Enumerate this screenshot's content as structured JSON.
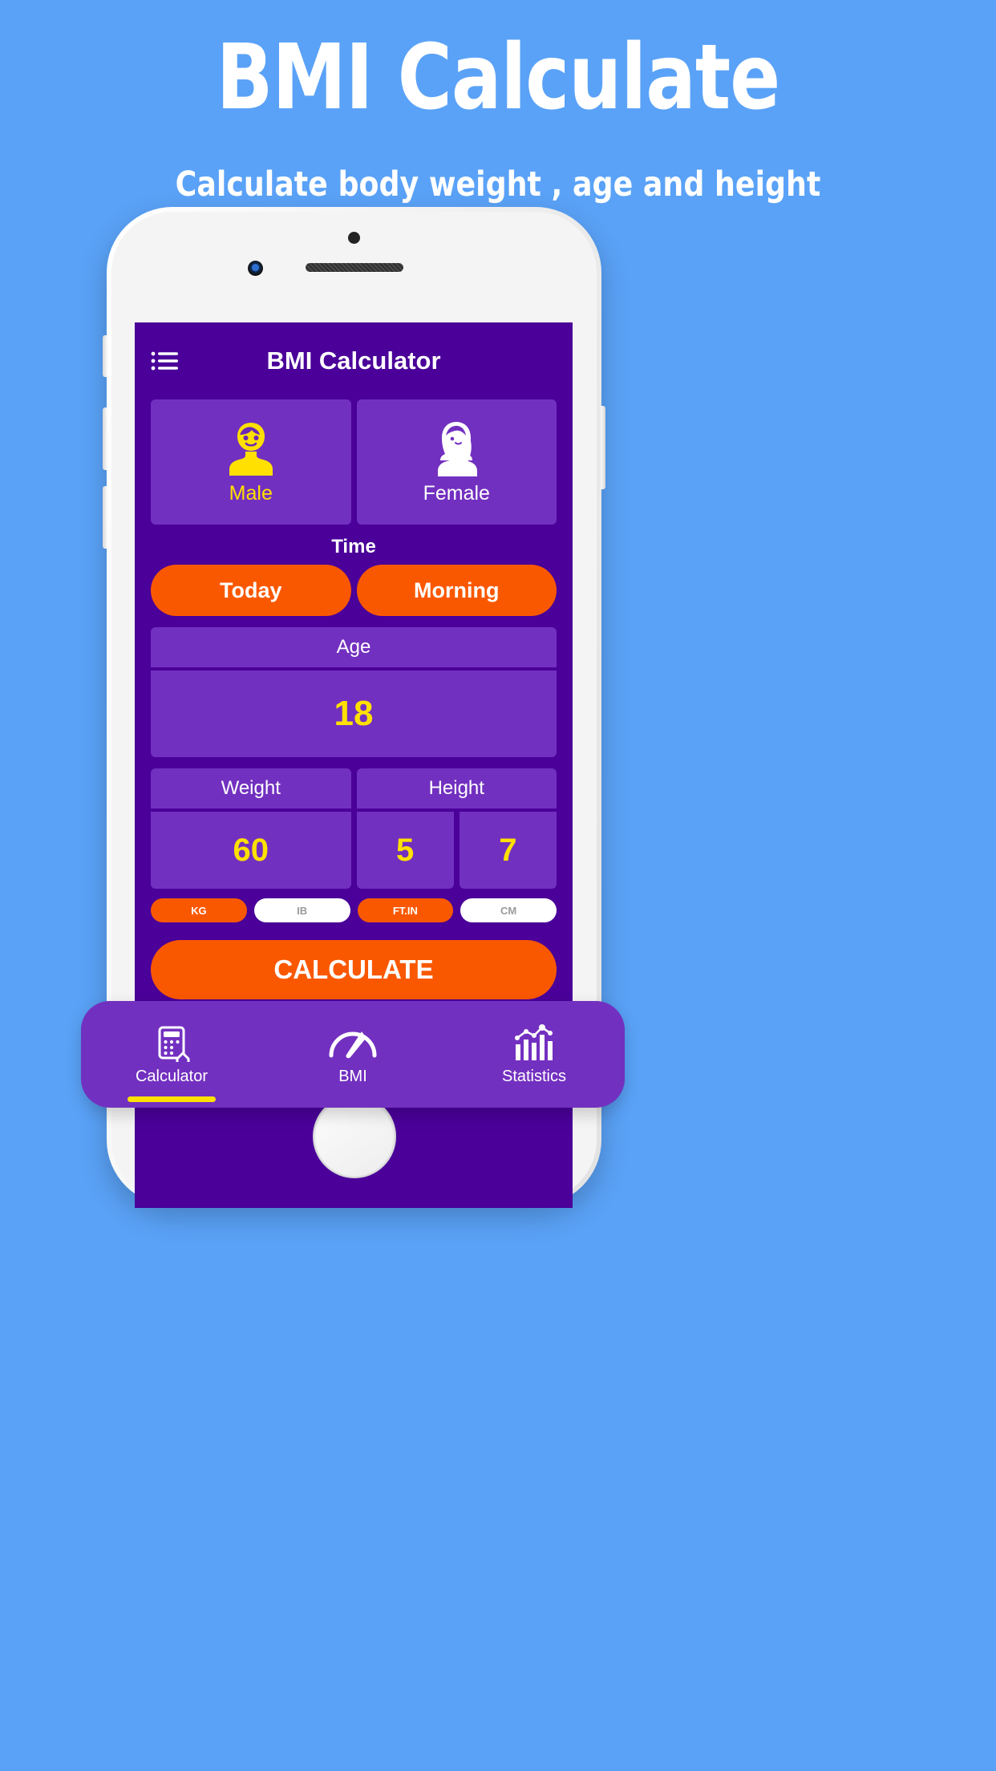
{
  "promo": {
    "title": "BMI Calculate",
    "subtitle": "Calculate body weight , age and height"
  },
  "app": {
    "header": {
      "title": "BMI Calculator",
      "menu_icon": "hamburger-list-icon"
    },
    "gender": {
      "male": {
        "label": "Male",
        "icon": "male-avatar-icon",
        "selected": true
      },
      "female": {
        "label": "Female",
        "icon": "female-avatar-icon",
        "selected": false
      }
    },
    "time": {
      "label": "Time",
      "day_button": "Today",
      "period_button": "Morning"
    },
    "age": {
      "label": "Age",
      "value": "18"
    },
    "weight": {
      "label": "Weight",
      "value": "60"
    },
    "height": {
      "label": "Height",
      "feet": "5",
      "inches": "7"
    },
    "units": [
      {
        "label": "KG",
        "active": true
      },
      {
        "label": "IB",
        "active": false
      },
      {
        "label": "FT.IN",
        "active": true
      },
      {
        "label": "CM",
        "active": false
      }
    ],
    "calculate_button": "CALCULATE",
    "bottom_nav": [
      {
        "label": "Calculator",
        "icon": "calculator-icon",
        "active": true
      },
      {
        "label": "BMI",
        "icon": "gauge-icon",
        "active": false
      },
      {
        "label": "Statistics",
        "icon": "bar-chart-icon",
        "active": false
      }
    ]
  },
  "colors": {
    "promo_background": "#5AA2F7",
    "app_background": "#4A0099",
    "card": "#7230C0",
    "accent_orange": "#FA5800",
    "accent_yellow": "#FFE000"
  }
}
